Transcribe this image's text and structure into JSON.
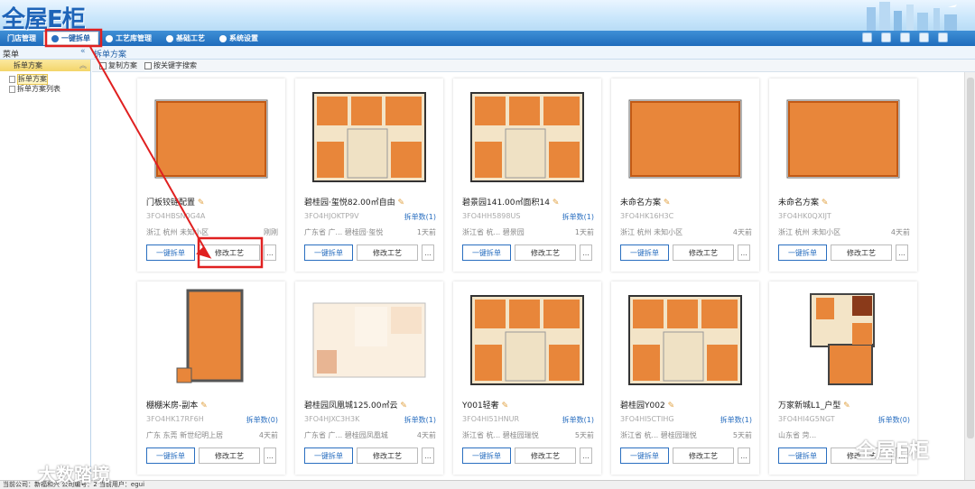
{
  "app": {
    "logo": "全屋E柜"
  },
  "nav": {
    "items": [
      {
        "label": "门店管理",
        "active": false
      },
      {
        "label": "一键拆单",
        "active": true
      },
      {
        "label": "工艺库管理",
        "active": false
      },
      {
        "label": "基础工艺",
        "active": false
      },
      {
        "label": "系统设置",
        "active": false
      }
    ]
  },
  "subrow": {
    "left": "菜单",
    "collapse": "«",
    "crumb": "拆单方案"
  },
  "sidebar": {
    "header": "拆单方案",
    "items": [
      "拆单方案",
      "拆单方案列表"
    ]
  },
  "toolbar": {
    "copy": "复制方案",
    "search": "按关键字搜索"
  },
  "cards": [
    {
      "title": "门板铰链配置",
      "code": "3FO4HBSN0G4A",
      "count": "",
      "loc": "浙江 杭州 未知小区",
      "time": "刚刚",
      "plan": "rect"
    },
    {
      "title": "碧桂园·玺悦82.00㎡自由",
      "code": "3FO4HJOKTP9V",
      "count": "拆单数(1)",
      "loc": "广东省 广... 碧桂园·玺悦",
      "time": "1天前",
      "plan": "complex"
    },
    {
      "title": "碧景园141.00㎡面积14",
      "code": "3FO4HH5898US",
      "count": "拆单数(1)",
      "loc": "浙江省 杭... 碧景园",
      "time": "1天前",
      "plan": "complex"
    },
    {
      "title": "未命名方案",
      "code": "3FO4HK16H3C",
      "count": "",
      "loc": "浙江 杭州 未知小区",
      "time": "4天前",
      "plan": "rect"
    },
    {
      "title": "未命名方案",
      "code": "3FO4HK0QXIJT",
      "count": "",
      "loc": "浙江 杭州 未知小区",
      "time": "4天前",
      "plan": "rect"
    },
    {
      "title": "棚棚米房-副本",
      "code": "3FO4HK17RF6H",
      "count": "拆单数(0)",
      "loc": "广东 东莞 新世纪明上居",
      "time": "4天前",
      "plan": "tall"
    },
    {
      "title": "碧桂园凤凰城125.00㎡云",
      "code": "3FO4HJXC3H3K",
      "count": "拆单数(1)",
      "loc": "广东省 广... 碧桂园凤凰城",
      "time": "4天前",
      "plan": "faded"
    },
    {
      "title": "Y001轻奢",
      "code": "3FO4HI51HNUR",
      "count": "拆单数(1)",
      "loc": "浙江省 杭... 碧桂园瑞悦",
      "time": "5天前",
      "plan": "complex"
    },
    {
      "title": "碧桂园Y002",
      "code": "3FO4HI5CTIHG",
      "count": "拆单数(1)",
      "loc": "浙江省 杭... 碧桂园瑞悦",
      "time": "5天前",
      "plan": "complex"
    },
    {
      "title": "万家新城L1_户型",
      "code": "3FO4HI4G5NGT",
      "count": "拆单数(0)",
      "loc": "山东省 菏...",
      "time": "",
      "plan": "tall2"
    }
  ],
  "buttons": {
    "split": "一键拆单",
    "edit": "修改工艺",
    "more": "..."
  },
  "status": "当前公司：新福和兴   公司编号：2   当前用户：egui",
  "watermarks": {
    "left": "大数踏境",
    "right": "全屋E柜"
  },
  "colors": {
    "nav": "#1f6cbc",
    "accent": "#2a6fc0",
    "annotation": "#e02020",
    "floor": "#e8863a"
  }
}
